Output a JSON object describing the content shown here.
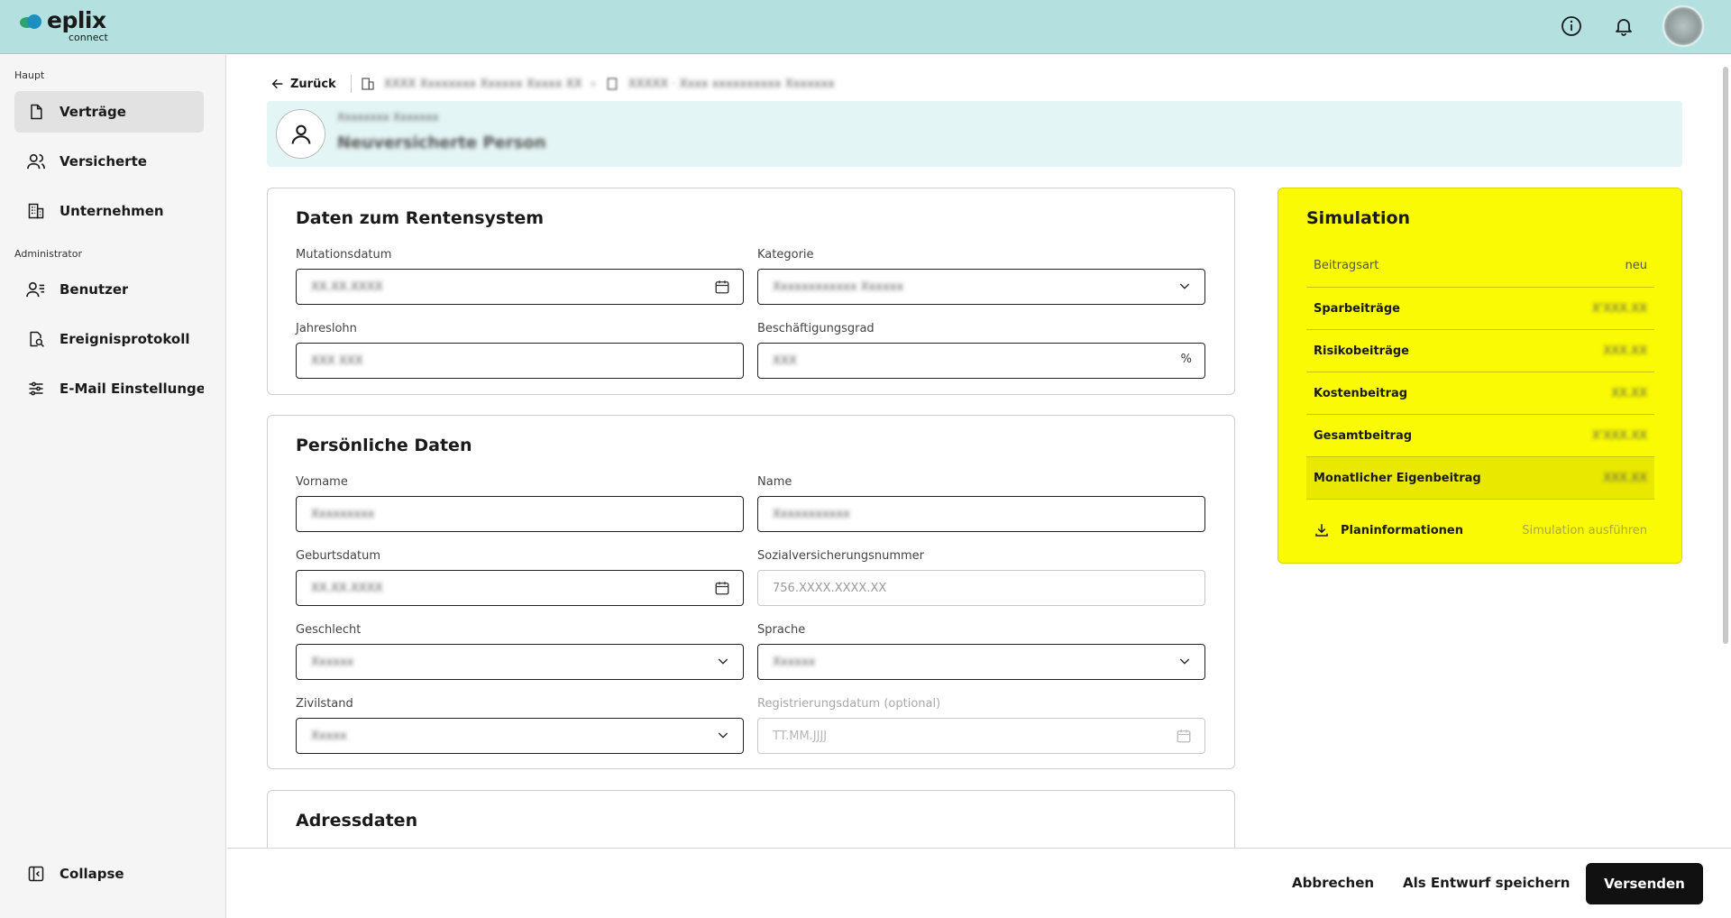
{
  "app": {
    "logo_name": "eplix",
    "logo_sub": "connect"
  },
  "colors": {
    "topbar": "#b4e0e0",
    "simulation": "#fafa05",
    "primary_button": "#111111"
  },
  "sidebar": {
    "section_main": "Haupt",
    "section_admin": "Administrator",
    "items": [
      {
        "label": "Verträge",
        "icon": "document-icon",
        "active": true
      },
      {
        "label": "Versicherte",
        "icon": "users-icon"
      },
      {
        "label": "Unternehmen",
        "icon": "building-icon"
      },
      {
        "label": "Benutzer",
        "icon": "user-admin-icon"
      },
      {
        "label": "Ereignisprotokoll",
        "icon": "log-search-icon"
      },
      {
        "label": "E-Mail Einstellungen",
        "icon": "sliders-icon"
      }
    ],
    "collapse_label": "Collapse"
  },
  "breadcrumb": {
    "back_label": "Zurück",
    "company": "XXXX Xxxxxxxx Xxxxxx Xxxxx XX",
    "contract": "XXXXX · Xxxx xxxxxxxxxx Xxxxxxx"
  },
  "banner": {
    "subtitle": "Xxxxxxxx Xxxxxxx",
    "title": "Neuversicherte Person"
  },
  "rentensystem": {
    "title": "Daten zum Rentensystem",
    "mutationsdatum": {
      "label": "Mutationsdatum",
      "value": "XX.XX.XXXX"
    },
    "kategorie": {
      "label": "Kategorie",
      "value": "Xxxxxxxxxxxx Xxxxxx"
    },
    "jahreslohn": {
      "label": "Jahreslohn",
      "value": "XXX XXX"
    },
    "beschaeftigungsgrad": {
      "label": "Beschäftigungsgrad",
      "value": "XXX",
      "suffix": "%"
    }
  },
  "persoenlich": {
    "title": "Persönliche Daten",
    "vorname": {
      "label": "Vorname",
      "value": "Xxxxxxxxx"
    },
    "name": {
      "label": "Name",
      "value": "Xxxxxxxxxxx"
    },
    "geburtsdatum": {
      "label": "Geburtsdatum",
      "value": "XX.XX.XXXX"
    },
    "svnr": {
      "label": "Sozialversicherungsnummer",
      "placeholder": "756.XXXX.XXXX.XX"
    },
    "geschlecht": {
      "label": "Geschlecht",
      "value": "Xxxxxx"
    },
    "sprache": {
      "label": "Sprache",
      "value": "Xxxxxx"
    },
    "zivilstand": {
      "label": "Zivilstand",
      "value": "Xxxxx"
    },
    "registrierungsdatum": {
      "label": "Registrierungsdatum (optional)",
      "placeholder": "TT.MM.JJJJ"
    }
  },
  "adresse": {
    "title": "Adressdaten"
  },
  "simulation": {
    "title": "Simulation",
    "header": {
      "label": "Beitragsart",
      "value": "neu"
    },
    "rows": [
      {
        "label": "Sparbeiträge",
        "value": "X'XXX.XX"
      },
      {
        "label": "Risikobeiträge",
        "value": "XXX.XX"
      },
      {
        "label": "Kostenbeitrag",
        "value": "XX.XX"
      },
      {
        "label": "Gesamtbeitrag",
        "value": "X'XXX.XX"
      },
      {
        "label": "Monatlicher Eigenbeitrag",
        "value": "XXX.XX"
      }
    ],
    "plan_label": "Planinformationen",
    "run_label": "Simulation ausführen"
  },
  "actions": {
    "cancel": "Abbrechen",
    "draft": "Als Entwurf speichern",
    "send": "Versenden"
  }
}
